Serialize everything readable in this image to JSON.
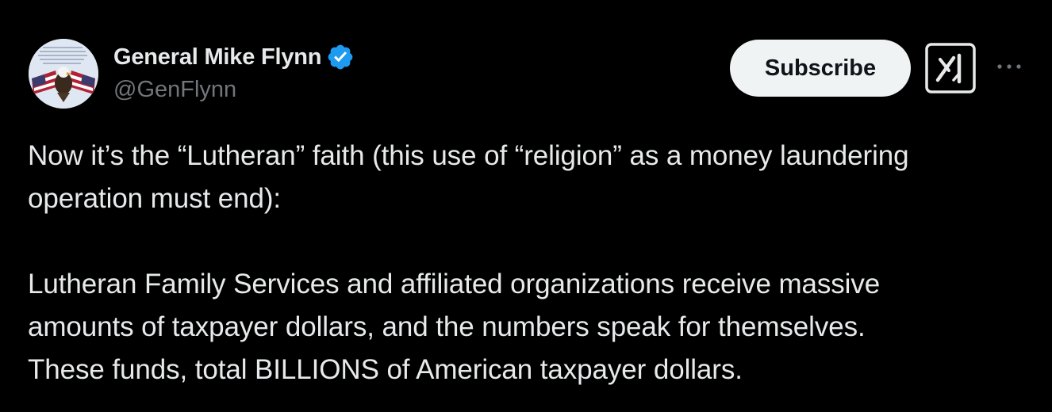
{
  "author": {
    "display_name": "General Mike Flynn",
    "handle": "@GenFlynn",
    "verified": true,
    "verified_color": "#1d9bf0"
  },
  "actions": {
    "subscribe_label": "Subscribe",
    "grok_icon": "grok-icon",
    "more_icon": "more-icon"
  },
  "post": {
    "paragraph1_line1": "Now it’s the “Lutheran” faith (this use of “religion” as a money laundering",
    "paragraph1_line2": "operation must end):",
    "paragraph2_line1": "Lutheran Family Services and affiliated organizations receive massive",
    "paragraph2_line2": "amounts of taxpayer dollars, and the numbers speak for themselves.",
    "paragraph2_line3": "These funds, total BILLIONS of American taxpayer dollars."
  },
  "colors": {
    "background": "#000000",
    "text_primary": "#e7e9ea",
    "text_secondary": "#71767b",
    "subscribe_bg": "#eff3f4"
  }
}
